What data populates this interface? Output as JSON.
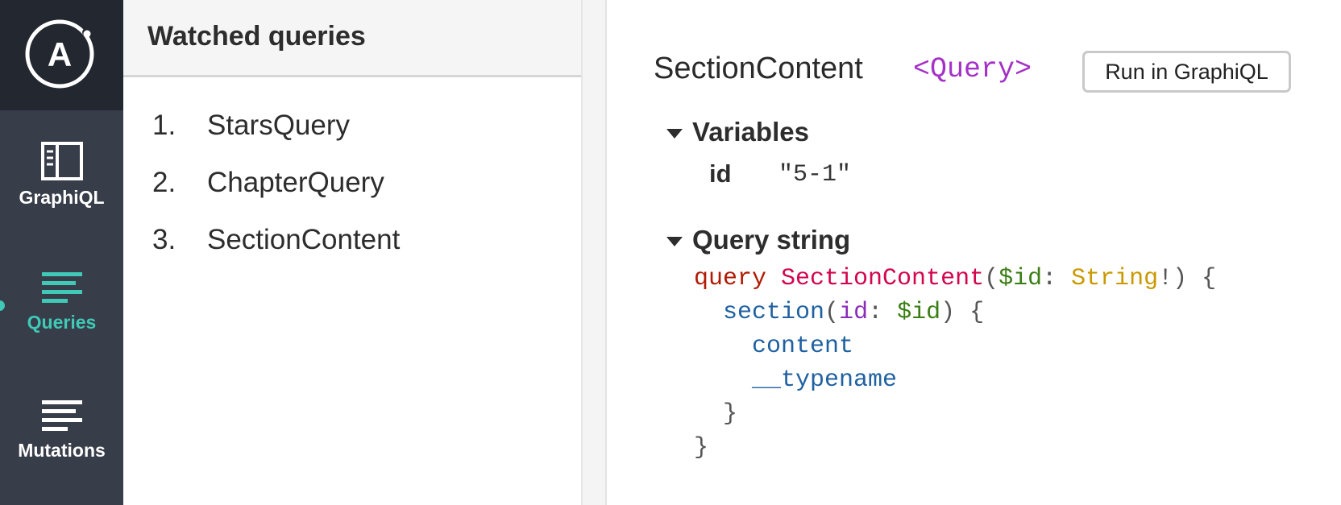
{
  "rail": {
    "items": [
      {
        "label": "GraphiQL",
        "icon": "graphiql-icon"
      },
      {
        "label": "Queries",
        "icon": "queries-icon",
        "active": true
      },
      {
        "label": "Mutations",
        "icon": "mutations-icon"
      }
    ],
    "logo_letter": "A",
    "colors": {
      "rail": "#383d4a",
      "logo_bg": "#23272f",
      "accent": "#3fc9b6"
    }
  },
  "list": {
    "header": "Watched queries",
    "items": [
      {
        "num": "1.",
        "name": "StarsQuery"
      },
      {
        "num": "2.",
        "name": "ChapterQuery"
      },
      {
        "num": "3.",
        "name": "SectionContent"
      }
    ]
  },
  "details": {
    "title": "SectionContent",
    "type_tag": "<Query>",
    "run_button": "Run in GraphiQL",
    "variables": {
      "heading": "Variables",
      "rows": [
        {
          "key": "id",
          "value": "\"5-1\""
        }
      ]
    },
    "query": {
      "heading": "Query string",
      "tokens": {
        "kw_query": "query",
        "op_name": "SectionContent",
        "paren_open": "(",
        "var_id": "$id",
        "colon": ":",
        "type_string": "String",
        "bang_close": "!) {",
        "field_section": "section",
        "arg_paren": "(",
        "arg_id": "id",
        "arg_colon": ":",
        "arg_var": "$id",
        "arg_close": ") {",
        "field_content": "content",
        "field_typename": "__typename",
        "close_inner": "}",
        "close_outer": "}"
      }
    }
  }
}
